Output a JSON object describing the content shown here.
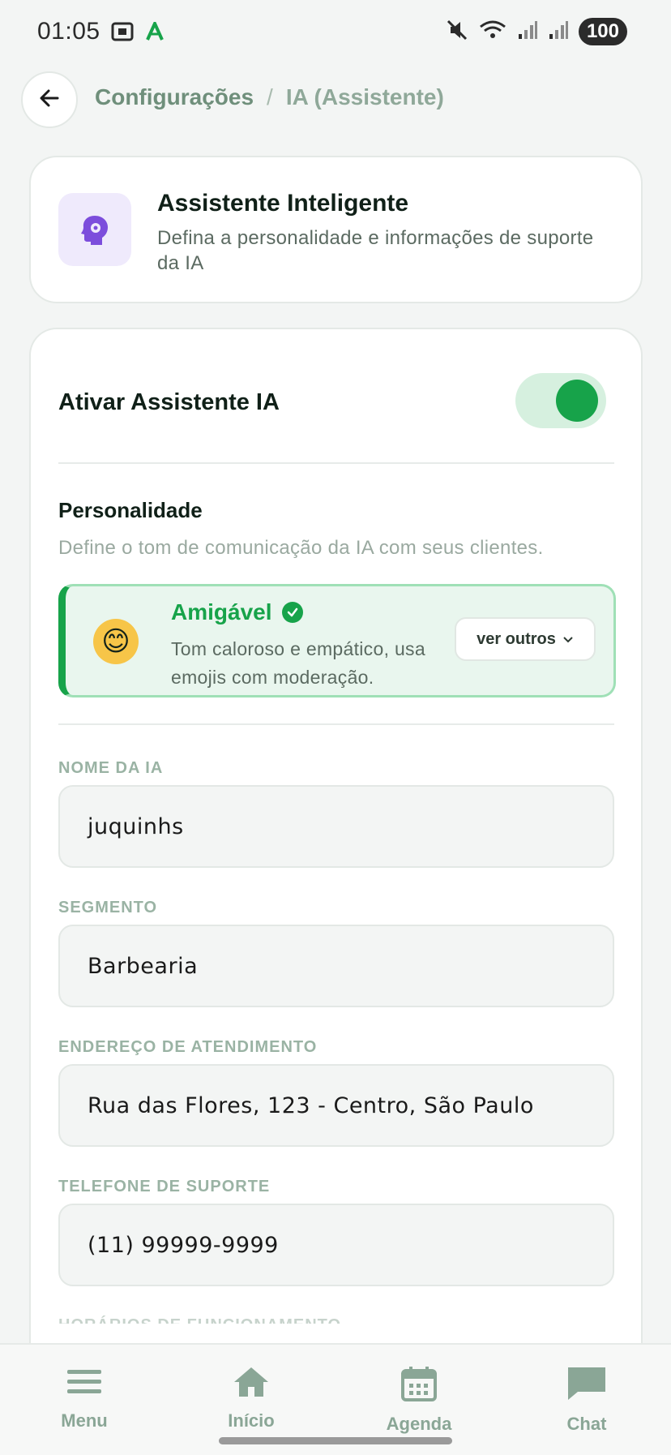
{
  "status_bar": {
    "time": "01:05",
    "battery": "100"
  },
  "header": {
    "breadcrumb_parent": "Configurações",
    "breadcrumb_separator": "/",
    "breadcrumb_current": "IA (Assistente)"
  },
  "info_card": {
    "title": "Assistente Inteligente",
    "description": "Defina a personalidade e informações de suporte da IA",
    "icon": "brain-gear-icon",
    "icon_color": "#7c4ddc"
  },
  "toggle": {
    "label": "Ativar Assistente IA",
    "enabled": true,
    "accent_color": "#17a34a"
  },
  "personality": {
    "title": "Personalidade",
    "description": "Define o tom de comunicação da IA com seus clientes.",
    "selected": {
      "emoji": "😊",
      "name": "Amigável",
      "description": "Tom caloroso e empático, usa emojis com moderação."
    },
    "more_button": "ver outros"
  },
  "fields": {
    "name": {
      "label": "NOME DA IA",
      "value": "juquinhs"
    },
    "segment": {
      "label": "SEGMENTO",
      "value": "Barbearia"
    },
    "address": {
      "label": "ENDEREÇO DE ATENDIMENTO",
      "value": "Rua das Flores, 123 - Centro, São Paulo"
    },
    "phone": {
      "label": "TELEFONE DE SUPORTE",
      "value": "(11) 99999-9999"
    },
    "hours": {
      "label": "HORÁRIOS DE FUNCIONAMENTO"
    }
  },
  "bottom_nav": {
    "menu": "Menu",
    "inicio": "Início",
    "agenda": "Agenda",
    "chat": "Chat"
  }
}
